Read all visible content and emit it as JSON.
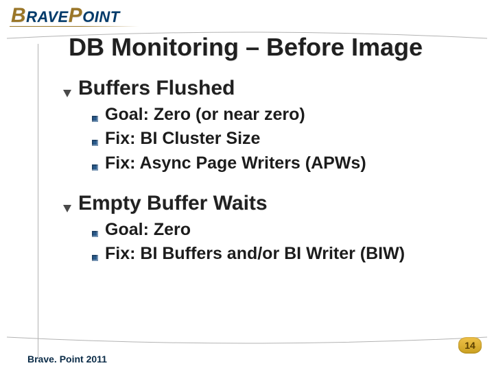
{
  "logo": {
    "part1_initial": "B",
    "part1_rest": "RAVE",
    "part2_initial": "P",
    "part2_rest": "OINT"
  },
  "title": "DB Monitoring – Before Image",
  "sections": [
    {
      "heading": "Buffers Flushed",
      "items": [
        "Goal: Zero (or near zero)",
        "Fix: BI Cluster Size",
        "Fix: Async Page Writers (APWs)"
      ]
    },
    {
      "heading": "Empty Buffer Waits",
      "items": [
        "Goal: Zero",
        "Fix: BI Buffers and/or BI Writer (BIW)"
      ]
    }
  ],
  "page_number": "14",
  "footer": "Brave. Point 2011"
}
